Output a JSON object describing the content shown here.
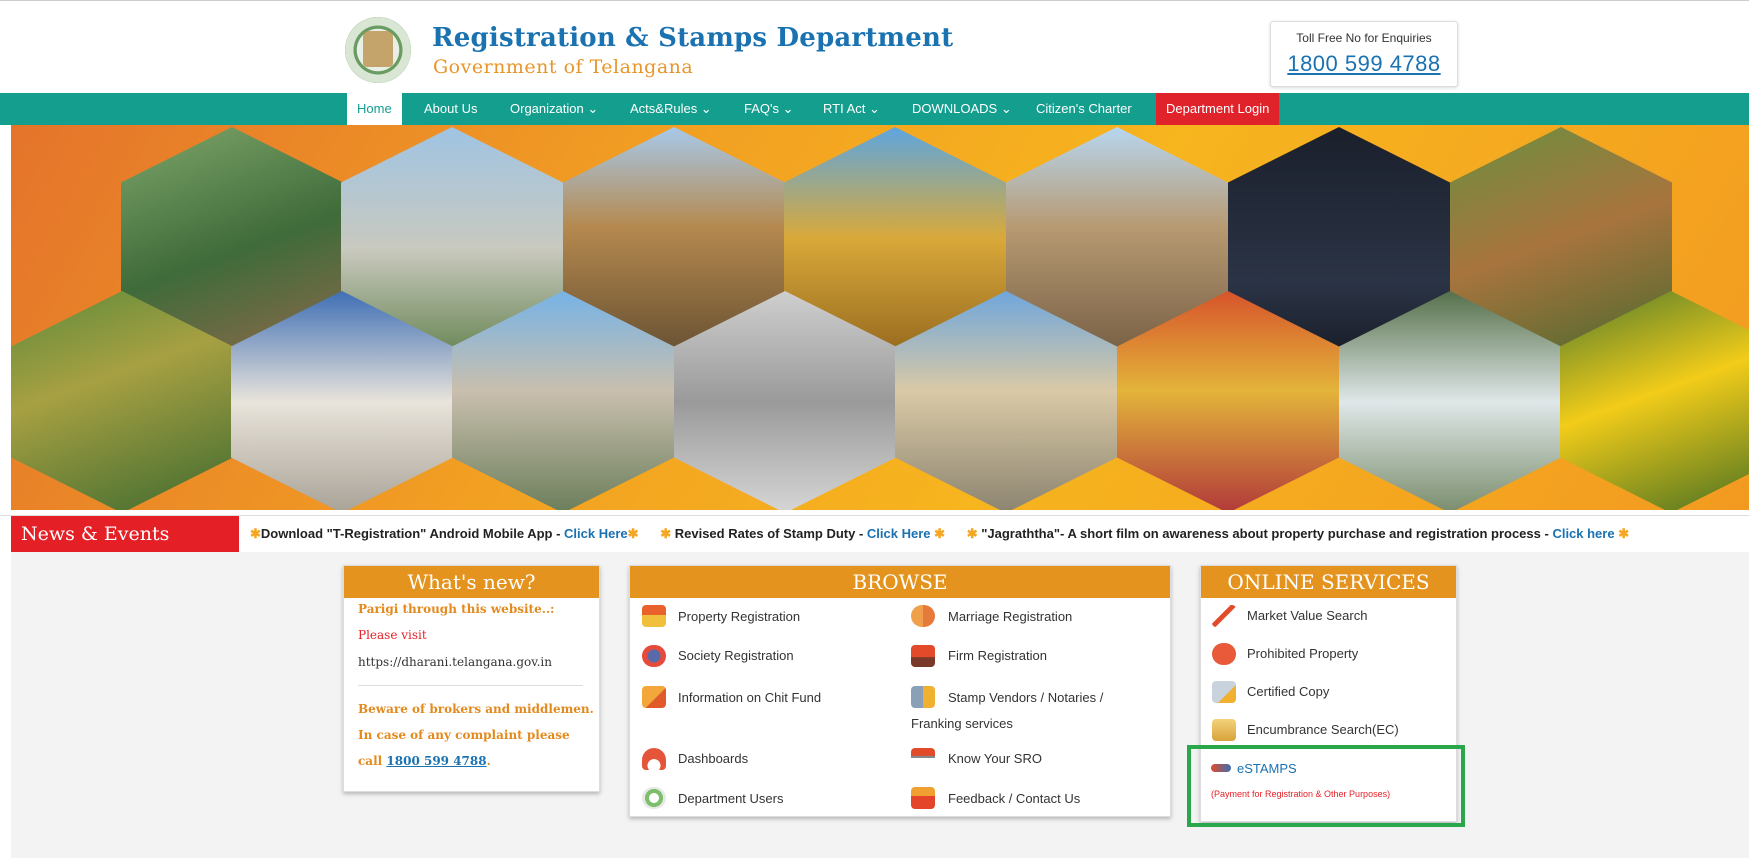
{
  "header": {
    "title": "Registration & Stamps Department",
    "subtitle": "Government of Telangana",
    "toll_label": "Toll Free No for Enquiries",
    "toll_number": "1800 599 4788"
  },
  "nav": {
    "items": [
      "Home",
      "About Us",
      "Organization ⌄",
      "Acts&Rules ⌄",
      "FAQ's ⌄",
      "RTI Act ⌄",
      "DOWNLOADS ⌄",
      "Citizen's Charter",
      "Department Login"
    ]
  },
  "news": {
    "label": "News & Events",
    "items": [
      {
        "text": "Download \"T-Registration\" Android Mobile App - ",
        "link": "Click Here"
      },
      {
        "text": "Revised Rates of Stamp Duty - ",
        "link": "Click Here"
      },
      {
        "text": "\"Jagraththa\"- A short film on awareness about property purchase and registration process - ",
        "link": "Click here"
      }
    ]
  },
  "whats_new": {
    "title": "What's new?",
    "line1": "Parigi through this website..:",
    "line2": "Please visit",
    "line3": "https://dharani.telangana.gov.in",
    "line4": "Beware of brokers and middlemen.",
    "line5": "In case of any complaint please",
    "call_prefix": "call ",
    "call_number": "1800 599 4788",
    "call_suffix": "."
  },
  "browse": {
    "title": "BROWSE",
    "items": [
      "Property Registration",
      "Marriage Registration",
      "Society Registration",
      "Firm Registration",
      "Information on Chit Fund",
      "Stamp Vendors / Notaries /",
      "Franking services",
      "Dashboards",
      "Know Your SRO",
      "Department Users",
      "Feedback / Contact Us"
    ]
  },
  "online_services": {
    "title": "ONLINE SERVICES",
    "items": [
      "Market Value Search",
      "Prohibited Property",
      "Certified Copy",
      "Encumbrance Search(EC)"
    ],
    "estamps_title": "eSTAMPS",
    "estamps_note": "(Payment for Registration & Other Purposes)"
  },
  "colors": {
    "teal_nav": "#149e8e",
    "orange_accent": "#e4941e",
    "red_alert": "#e51f26",
    "link_blue": "#1a72b0",
    "highlight_green": "#2aa64b"
  }
}
